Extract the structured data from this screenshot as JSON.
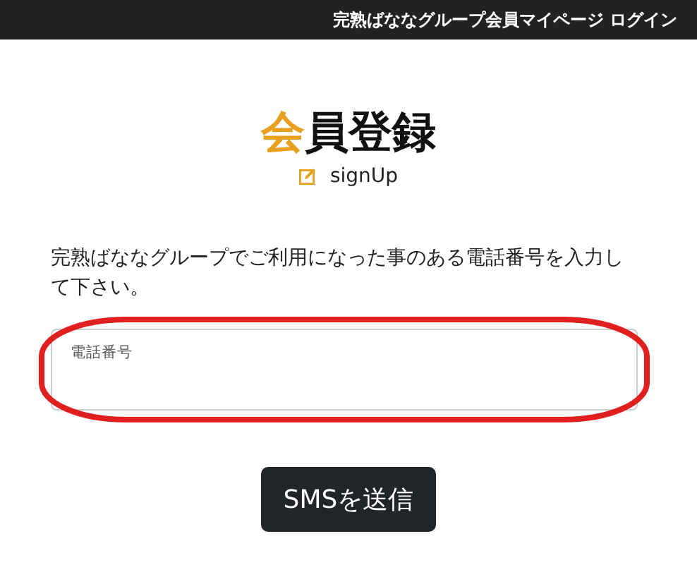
{
  "header": {
    "title": "完熟ばななグループ会員マイページ ログイン"
  },
  "heading": {
    "title": "会員登録",
    "subtitle": "signUp"
  },
  "instructions": "完熟ばななグループでご利用になった事のある電話番号を入力して下さい。",
  "phone_field": {
    "placeholder": "電話番号",
    "highlighted": true
  },
  "buttons": [
    "SMSを送信"
  ]
}
